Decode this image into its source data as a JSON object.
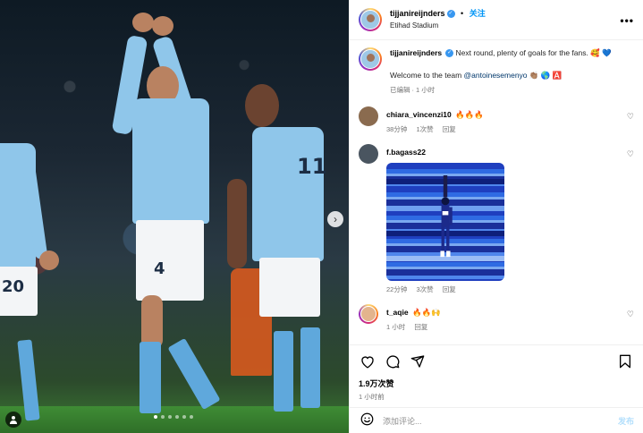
{
  "post": {
    "author": "tijjanireijnders",
    "follow_label": "关注",
    "separator": "•",
    "location": "Etihad Stadium",
    "more_icon": "more-options-icon"
  },
  "photo": {
    "shirt_number_1": "4",
    "shirt_number_2": "11",
    "shirt_number_3": "20",
    "next_icon": "›",
    "tag_icon": "person-tag-icon"
  },
  "caption": {
    "username": "tijjanireijnders",
    "line1": "Next round, plenty of goals for the fans. 🥰 💙",
    "line2_prefix": "Welcome to the team ",
    "mention": "@antoinesemenyo",
    "line2_suffix": " 👏🏽 🌎 🅰️",
    "edited": "已编辑",
    "dot": "·",
    "time": "1 小时"
  },
  "comments": [
    {
      "username": "chiara_vincenzi10",
      "text": "🔥🔥🔥",
      "time": "38分钟",
      "likes": "1次赞",
      "reply": "回复"
    },
    {
      "username": "f.bagass22",
      "text": "",
      "time": "22分钟",
      "likes": "3次赞",
      "reply": "回复"
    },
    {
      "username": "t_aqie",
      "text": "🔥🔥🙌",
      "time": "1 小时",
      "reply": "回复"
    }
  ],
  "actions": {
    "likes": "1.9万次赞",
    "time": "1 小时前"
  },
  "add_comment": {
    "placeholder": "添加评论...",
    "post_label": "发布"
  },
  "colors": {
    "sky_blue_kit": "#8fc6ea",
    "instagram_blue": "#0095f6",
    "post_disabled": "#b3dffc"
  }
}
